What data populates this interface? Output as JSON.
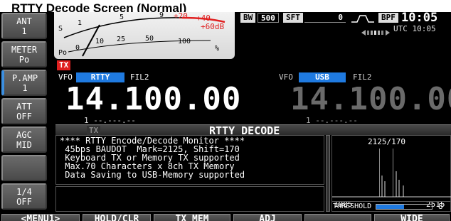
{
  "caption": "RTTY Decode Screen (Normal)",
  "side_buttons": [
    {
      "line1": "ANT",
      "line2": "1"
    },
    {
      "line1": "METER",
      "line2": "Po"
    },
    {
      "line1": "P.AMP",
      "line2": "1"
    },
    {
      "line1": "ATT",
      "line2": "OFF"
    },
    {
      "line1": "AGC",
      "line2": "MID"
    },
    {
      "line1": "",
      "line2": ""
    },
    {
      "line1": "1/4",
      "line2": "OFF"
    }
  ],
  "meter": {
    "scale_top": [
      "S",
      "1",
      "5",
      "9",
      "+20",
      "+40",
      "+60dB"
    ],
    "scale_bottom": [
      "Po",
      "0",
      "10",
      "25",
      "50",
      "100",
      "%"
    ]
  },
  "status": {
    "bw_label": "BW",
    "bw_value": "500",
    "sft_label": "SFT",
    "sft_value": "0",
    "bpf_label": "BPF",
    "time": "10:05",
    "utc": "UTC 10:05"
  },
  "tx_indicator": "TX",
  "main": {
    "vfo_label": "VFO",
    "mode": "RTTY",
    "filter": "FIL2",
    "frequency": "14.100.00",
    "sub": "1  --.---.--"
  },
  "sub": {
    "vfo_label": "VFO",
    "mode": "USB",
    "filter": "FIL2",
    "frequency": "14.100.00",
    "sub": "1  --.---.--"
  },
  "decode": {
    "title": "RTTY DECODE",
    "tx_badge": "TX",
    "lines": [
      "**** RTTY Encode/Decode Monitor ****",
      " 45bps BAUDOT  Mark=2125, Shift=170",
      " Keyboard TX or Memory TX supported",
      " Max.70 Characters x 8ch TX Memory",
      " Data Saving to USB-Memory supported"
    ]
  },
  "scope": {
    "header": "2125/170",
    "left_freq": "1905",
    "right_freq": "2515",
    "threshold_label": "THRESHOLD",
    "threshold_value": "8",
    "threshold_level_pct": 50
  },
  "bottom_buttons": [
    "<MENU1>",
    "HOLD/CLR",
    "TX MEM",
    "ADJ",
    "",
    "WIDE"
  ],
  "colors": {
    "accent": "#1f7ae0",
    "tx_red": "#e02020",
    "meter_red": "#ff3030"
  }
}
